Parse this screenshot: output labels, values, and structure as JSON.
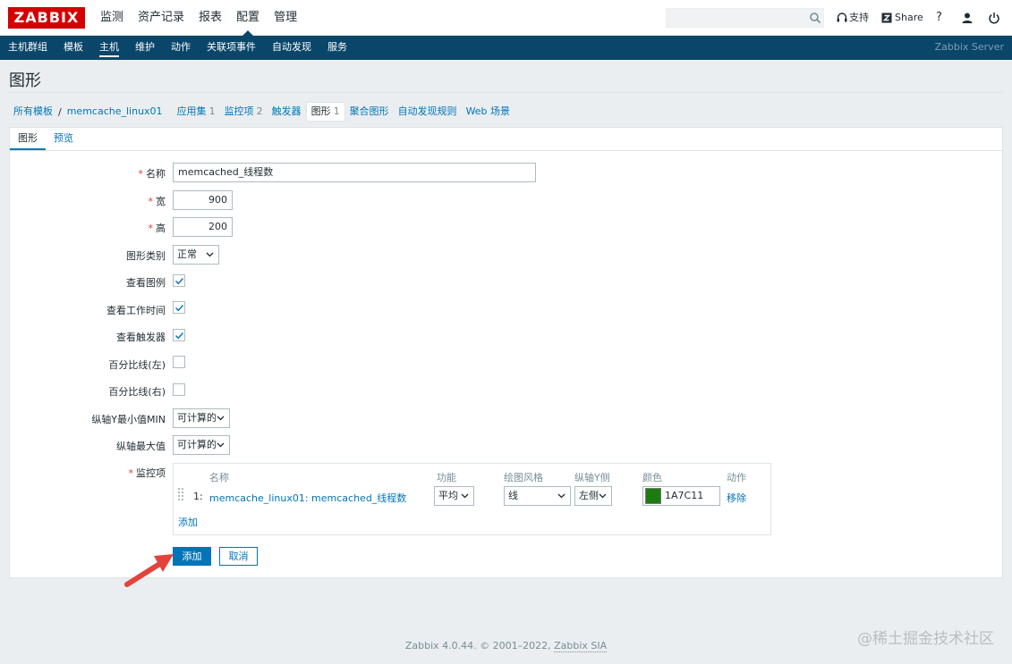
{
  "header": {
    "logo": "ZABBIX",
    "menu": [
      "监测",
      "资产记录",
      "报表",
      "配置",
      "管理"
    ],
    "active_menu": "配置",
    "support": "支持",
    "share": "Share",
    "help": "?"
  },
  "subnav": {
    "items": [
      "主机群组",
      "模板",
      "主机",
      "维护",
      "动作",
      "关联项事件",
      "自动发现",
      "服务"
    ],
    "active": "主机",
    "server": "Zabbix Server"
  },
  "page_title": "图形",
  "breadcrumb": {
    "all_templates": "所有模板",
    "separator": "/",
    "host": "memcache_linux01",
    "apps": "应用集",
    "apps_count": "1",
    "items": "监控项",
    "items_count": "2",
    "triggers": "触发器",
    "graphs": "图形",
    "graphs_count": "1",
    "screens": "聚合图形",
    "discovery": "自动发现规则",
    "web": "Web 场景"
  },
  "tabs": [
    "图形",
    "预览"
  ],
  "form": {
    "required_mark": "*",
    "name_label": "名称",
    "name_value": "memcached_线程数",
    "width_label": "宽",
    "width_value": "900",
    "height_label": "高",
    "height_value": "200",
    "type_label": "图形类别",
    "type_value": "正常",
    "show_legend_label": "查看图例",
    "show_working_time_label": "查看工作时间",
    "show_triggers_label": "查看触发器",
    "percentile_left_label": "百分比线(左)",
    "percentile_right_label": "百分比线(右)",
    "ymin_label": "纵轴Y最小值MIN",
    "ymin_value": "可计算的",
    "ymax_label": "纵轴最大值",
    "ymax_value": "可计算的",
    "items_label": "监控项"
  },
  "items_table": {
    "headers": {
      "name": "名称",
      "function": "功能",
      "draw_style": "绘图风格",
      "y_axis_side": "纵轴Y侧",
      "color": "颜色",
      "action": "动作"
    },
    "row": {
      "num": "1:",
      "name": "memcache_linux01: memcached_线程数",
      "function": "平均",
      "draw_style": "线",
      "y_axis_side": "左侧",
      "color": "1A7C11",
      "remove": "移除"
    },
    "add_link": "添加",
    "swatch_color": "#1a7c11"
  },
  "buttons": {
    "add": "添加",
    "cancel": "取消"
  },
  "footer": {
    "text": "Zabbix 4.0.44. © 2001–2022,",
    "link": "Zabbix SIA"
  },
  "watermark": "@稀土掘金技术社区"
}
